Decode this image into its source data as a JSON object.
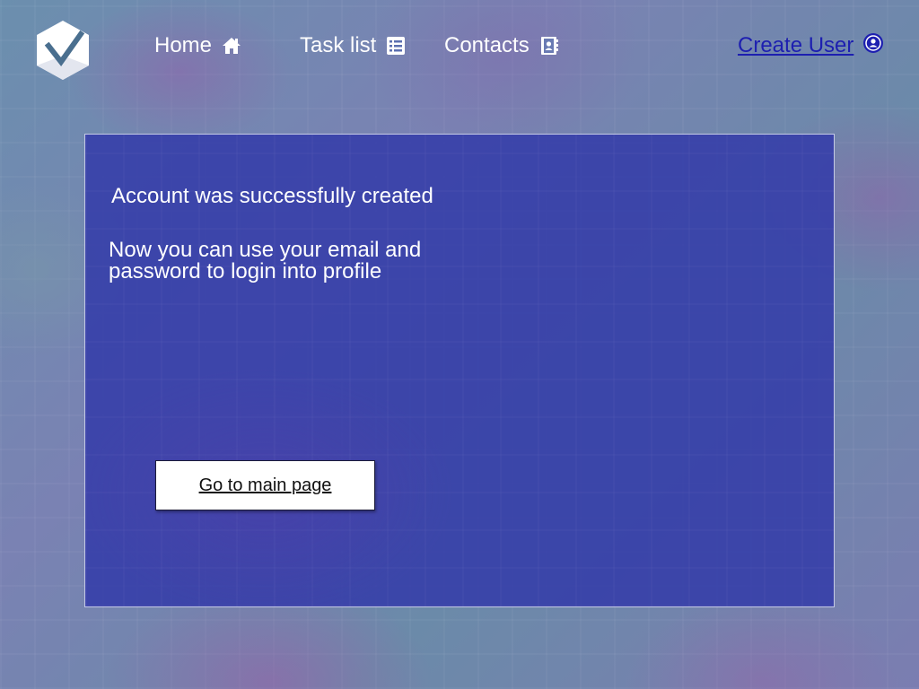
{
  "colors": {
    "panel": "#343ca8",
    "link": "#1d1fb0",
    "nav_text": "#ffffff",
    "button_bg": "#ffffff"
  },
  "logo": {
    "icon": "checkmark-hexagon-logo"
  },
  "nav": {
    "home": {
      "label": "Home",
      "icon": "home-icon"
    },
    "tasks": {
      "label": "Task list",
      "icon": "list-icon"
    },
    "contacts": {
      "label": "Contacts",
      "icon": "contact-book-icon"
    },
    "create_user": {
      "label": "Create User",
      "icon": "user-circle-icon"
    }
  },
  "panel": {
    "title": "Account was successfully created",
    "message": "Now you can use your email and password to login into profile",
    "button_label": "Go to main page"
  }
}
